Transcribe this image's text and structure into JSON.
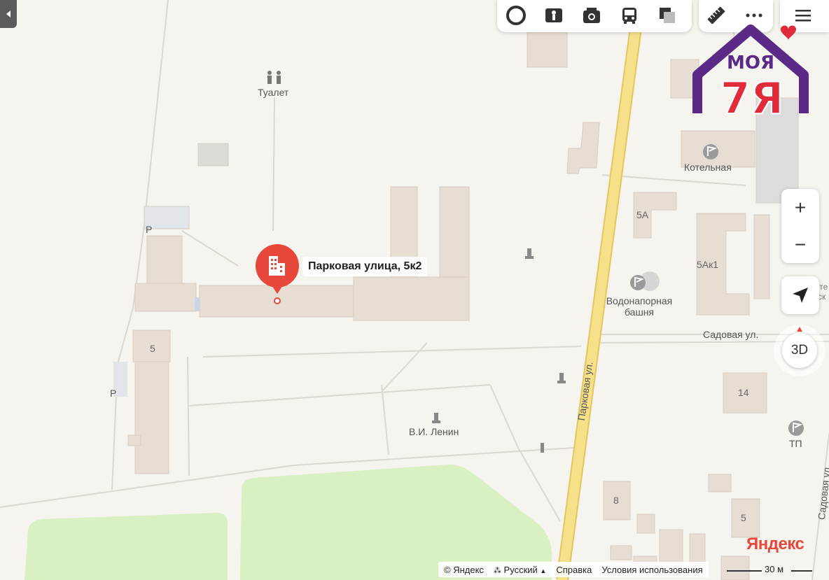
{
  "map": {
    "place_title": "Парковая улица, 5к2",
    "street_park": "Парковая ул.",
    "street_sad": "Садовая ул.",
    "street_sad_right": "Садовая ул.",
    "poi_toilet": "Туалет",
    "poi_boiler": "Котельная",
    "poi_tower": "Водонапорная башня",
    "poi_lenin": "В.И. Ленин",
    "poi_tp": "ТП",
    "parking": "P",
    "house_5": "5",
    "house_5a": "5А",
    "house_5ak1": "5Ак1",
    "house_14": "14",
    "house_8": "8",
    "house_5b": "5",
    "cut_label_top": "...ете",
    "cut_label_bottom": "...ск"
  },
  "controls": {
    "zoom_in": "+",
    "zoom_out": "−",
    "three_d": "3D"
  },
  "logo": {
    "line1": "МОЯ",
    "line2": "7Я"
  },
  "footer": {
    "copyright": "© Яндекс",
    "language": "Русский",
    "help": "Справка",
    "terms": "Условия использования",
    "scale": "30 м"
  },
  "brand": "Яндекс",
  "colors": {
    "land": "#f6f4ee",
    "building": "#e6ddd3",
    "road_main": "#f5db7a",
    "park": "#d9f0c2",
    "pin": "#e8473b"
  }
}
